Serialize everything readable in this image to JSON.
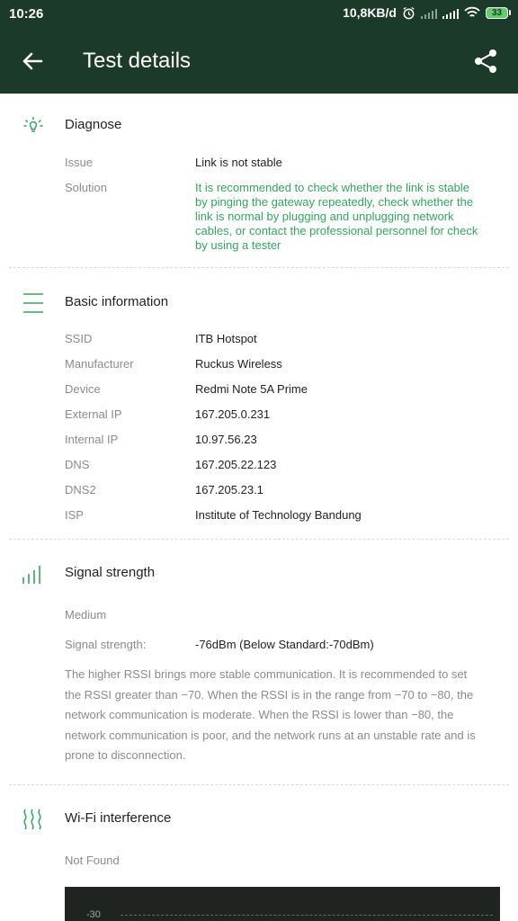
{
  "status_bar": {
    "time": "10:26",
    "speed": "10,8KB/d",
    "battery": "33",
    "icons": [
      "alarm-icon",
      "signal-icon",
      "signal-icon",
      "wifi-icon",
      "battery-icon"
    ]
  },
  "app_bar": {
    "title": "Test details",
    "back_icon": "arrow-left-icon",
    "share_icon": "share-icon"
  },
  "diagnose": {
    "heading": "Diagnose",
    "icon": "lightbulb-icon",
    "issue_label": "Issue",
    "issue_value": "Link is not stable",
    "solution_label": "Solution",
    "solution_lines": [
      "It is recommended to check whether the link is stable",
      "by pinging the gateway repeatedly, check whether the",
      "link is normal by plugging and unplugging network",
      "cables, or contact the professional personnel for check",
      "by using a tester"
    ]
  },
  "basic_info": {
    "heading": "Basic information",
    "icon": "list-icon",
    "rows": [
      {
        "label": "SSID",
        "value": "ITB Hotspot"
      },
      {
        "label": "Manufacturer",
        "value": "Ruckus Wireless"
      },
      {
        "label": "Device",
        "value": "Redmi Note 5A Prime"
      },
      {
        "label": "External IP",
        "value": "167.205.0.231"
      },
      {
        "label": "Internal IP",
        "value": "10.97.56.23"
      },
      {
        "label": "DNS",
        "value": "167.205.22.123"
      },
      {
        "label": "DNS2",
        "value": "167.205.23.1"
      },
      {
        "label": "ISP",
        "value": "Institute of Technology Bandung"
      }
    ]
  },
  "signal": {
    "heading": "Signal strength",
    "icon": "signal-bars-icon",
    "level": "Medium",
    "strength_label": "Signal strength:",
    "strength_value": "-76dBm (Below Standard:-70dBm)",
    "description_lines": [
      "The higher RSSI brings more stable communication. It is recommended to set",
      "the RSSI greater than −70. When the RSSI is in the range from −70 to −80, the",
      "network communication is moderate. When the RSSI is lower than −80, the",
      "network communication is poor, and the network runs at an unstable rate and is",
      "prone to disconnection."
    ]
  },
  "interference": {
    "heading": "Wi-Fi interference",
    "icon": "interference-waves-icon",
    "status": "Not Found",
    "chart_tick": "-30"
  },
  "colors": {
    "bar": "#1b3a2a",
    "accent": "#2fa85a",
    "chart_bg": "#1f2421"
  }
}
